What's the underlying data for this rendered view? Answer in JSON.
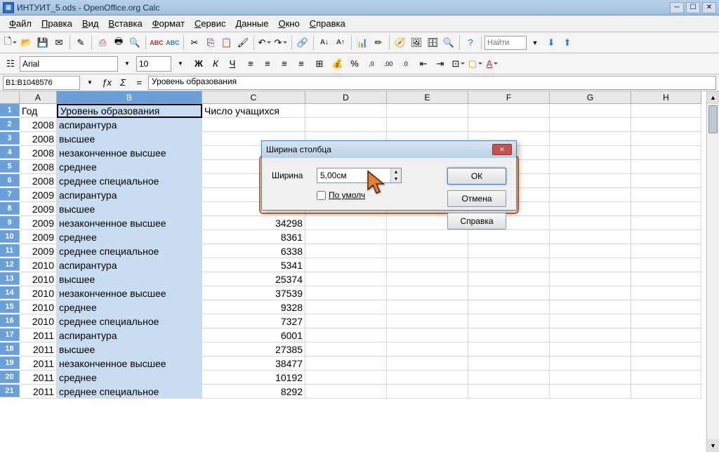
{
  "window": {
    "title": "ИНТУИТ_5.ods - OpenOffice.org Calc"
  },
  "menu": {
    "items": [
      "Файл",
      "Правка",
      "Вид",
      "Вставка",
      "Формат",
      "Сервис",
      "Данные",
      "Окно",
      "Справка"
    ]
  },
  "find": {
    "placeholder": "Найти"
  },
  "format": {
    "font_name": "Arial",
    "font_size": "10"
  },
  "formula": {
    "cell_ref": "B1:B1048576",
    "content": "Уровень образования"
  },
  "columns": [
    "A",
    "B",
    "C",
    "D",
    "E",
    "F",
    "G",
    "H"
  ],
  "headers": {
    "a": "Год",
    "b": "Уровень образования",
    "c": "Число учащихся"
  },
  "rows": [
    {
      "n": 1,
      "a": "Год",
      "b": "Уровень образования",
      "c": "Число учащихся",
      "header": true
    },
    {
      "n": 2,
      "a": "2008",
      "b": "аспирантура",
      "c": ""
    },
    {
      "n": 3,
      "a": "2008",
      "b": "высшее",
      "c": ""
    },
    {
      "n": 4,
      "a": "2008",
      "b": "незаконченное высшее",
      "c": ""
    },
    {
      "n": 5,
      "a": "2008",
      "b": "среднее",
      "c": ""
    },
    {
      "n": 6,
      "a": "2008",
      "b": "среднее специальное",
      "c": ""
    },
    {
      "n": 7,
      "a": "2009",
      "b": "аспирантура",
      "c": ""
    },
    {
      "n": 8,
      "a": "2009",
      "b": "высшее",
      "c": ""
    },
    {
      "n": 9,
      "a": "2009",
      "b": "незаконченное высшее",
      "c": "34298"
    },
    {
      "n": 10,
      "a": "2009",
      "b": "среднее",
      "c": "8361"
    },
    {
      "n": 11,
      "a": "2009",
      "b": "среднее специальное",
      "c": "6338"
    },
    {
      "n": 12,
      "a": "2010",
      "b": "аспирантура",
      "c": "5341"
    },
    {
      "n": 13,
      "a": "2010",
      "b": "высшее",
      "c": "25374"
    },
    {
      "n": 14,
      "a": "2010",
      "b": "незаконченное высшее",
      "c": "37539"
    },
    {
      "n": 15,
      "a": "2010",
      "b": "среднее",
      "c": "9328"
    },
    {
      "n": 16,
      "a": "2010",
      "b": "среднее специальное",
      "c": "7327"
    },
    {
      "n": 17,
      "a": "2011",
      "b": "аспирантура",
      "c": "6001"
    },
    {
      "n": 18,
      "a": "2011",
      "b": "высшее",
      "c": "27385"
    },
    {
      "n": 19,
      "a": "2011",
      "b": "незаконченное высшее",
      "c": "38477"
    },
    {
      "n": 20,
      "a": "2011",
      "b": "среднее",
      "c": "10192"
    },
    {
      "n": 21,
      "a": "2011",
      "b": "среднее специальное",
      "c": "8292"
    }
  ],
  "dialog": {
    "title": "Ширина столбца",
    "width_label": "Ширина",
    "width_value": "5,00см",
    "default_label": "По умолч",
    "ok": "ОК",
    "cancel": "Отмена",
    "help": "Справка"
  }
}
